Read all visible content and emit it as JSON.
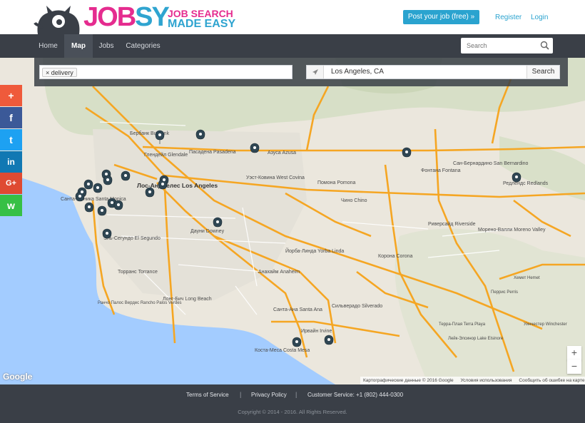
{
  "brand": {
    "logo_part1": "JOB",
    "logo_part2": "SY",
    "tagline_line1": "JOB SEARCH",
    "tagline_line2": "MADE EASY",
    "colors": {
      "pink": "#e52c8f",
      "blue": "#2fa4d0",
      "dark": "#3a3f47"
    }
  },
  "header": {
    "post_job": "Post your job (free) »",
    "register": "Register",
    "login": "Login"
  },
  "nav": {
    "items": [
      "Home",
      "Map",
      "Jobs",
      "Categories"
    ],
    "active": "Map",
    "search_placeholder": "Search"
  },
  "search": {
    "keyword_tag": "delivery",
    "location_value": "Los Angeles, CA",
    "search_button": "Search"
  },
  "share": [
    {
      "icon": "plus-icon",
      "glyph": "+",
      "color": "#ef5a3b"
    },
    {
      "icon": "facebook-icon",
      "glyph": "f",
      "color": "#3b5998"
    },
    {
      "icon": "twitter-icon",
      "glyph": "t",
      "color": "#1da1f2"
    },
    {
      "icon": "linkedin-icon",
      "glyph": "in",
      "color": "#1178b3"
    },
    {
      "icon": "google-plus-icon",
      "glyph": "G+",
      "color": "#df4a32"
    },
    {
      "icon": "whatsapp-icon",
      "glyph": "w",
      "color": "#36c045"
    }
  ],
  "map": {
    "places": {
      "burbank": "Бербанк Burbank",
      "glendale": "Глендейл Glendale",
      "pasadena": "Пасадена Pasadena",
      "azusa": "Азуса Azusa",
      "los_angeles": "Лос-Анджелес Los Angeles",
      "west_covina": "Уэст-Ковина West Covina",
      "pomona": "Помона Pomona",
      "chino": "Чино Chino",
      "fontana": "Фонтана Fontana",
      "san_bernardino": "Сан-Бернардино San Bernardino",
      "redlands": "Редлендс Redlands",
      "riverside": "Риверсайд Riverside",
      "moreno_valley": "Морено-Валли Moreno Valley",
      "santa_monica": "Санта-Моника Santa Monica",
      "el_segundo": "Эль-Сегундо El Segundo",
      "downey": "Дауни Downey",
      "torrance": "Торранс Torrance",
      "long_beach": "Лонг-Бич Long Beach",
      "anaheim": "Анахайм Anaheim",
      "yorba_linda": "Йорба-Линда Yorba Linda",
      "corona": "Корона Corona",
      "santa_ana": "Санта-Ана Santa Ana",
      "irvine": "Ирвайн Irvine",
      "costa_mesa": "Коста-Меса Costa Mesa",
      "silverado": "Сильверадо Silverado",
      "rancho_palos": "Ранчо Палос Вердес Rancho Palos Verdes",
      "lake_elsinore": "Лейк-Элсинор Lake Elsinore",
      "perris": "Перрис Perris",
      "hemet": "Хемет Hemet",
      "winchester": "Уинчестер Winchester",
      "temecula": "Терра-Плая Terra Playa"
    },
    "zoom_in": "+",
    "zoom_out": "−",
    "google": "Google",
    "attribution": {
      "data": "Картографические данные © 2016 Google",
      "terms": "Условия использования",
      "report": "Сообщить об ошибке на карте"
    }
  },
  "footer": {
    "terms": "Terms of Service",
    "privacy": "Privacy Policy",
    "customer_service": "Customer Service: +1 (802) 444-0300",
    "separator": "|",
    "copyright": "Copyright © 2014 - 2016. All Rights Reserved."
  }
}
